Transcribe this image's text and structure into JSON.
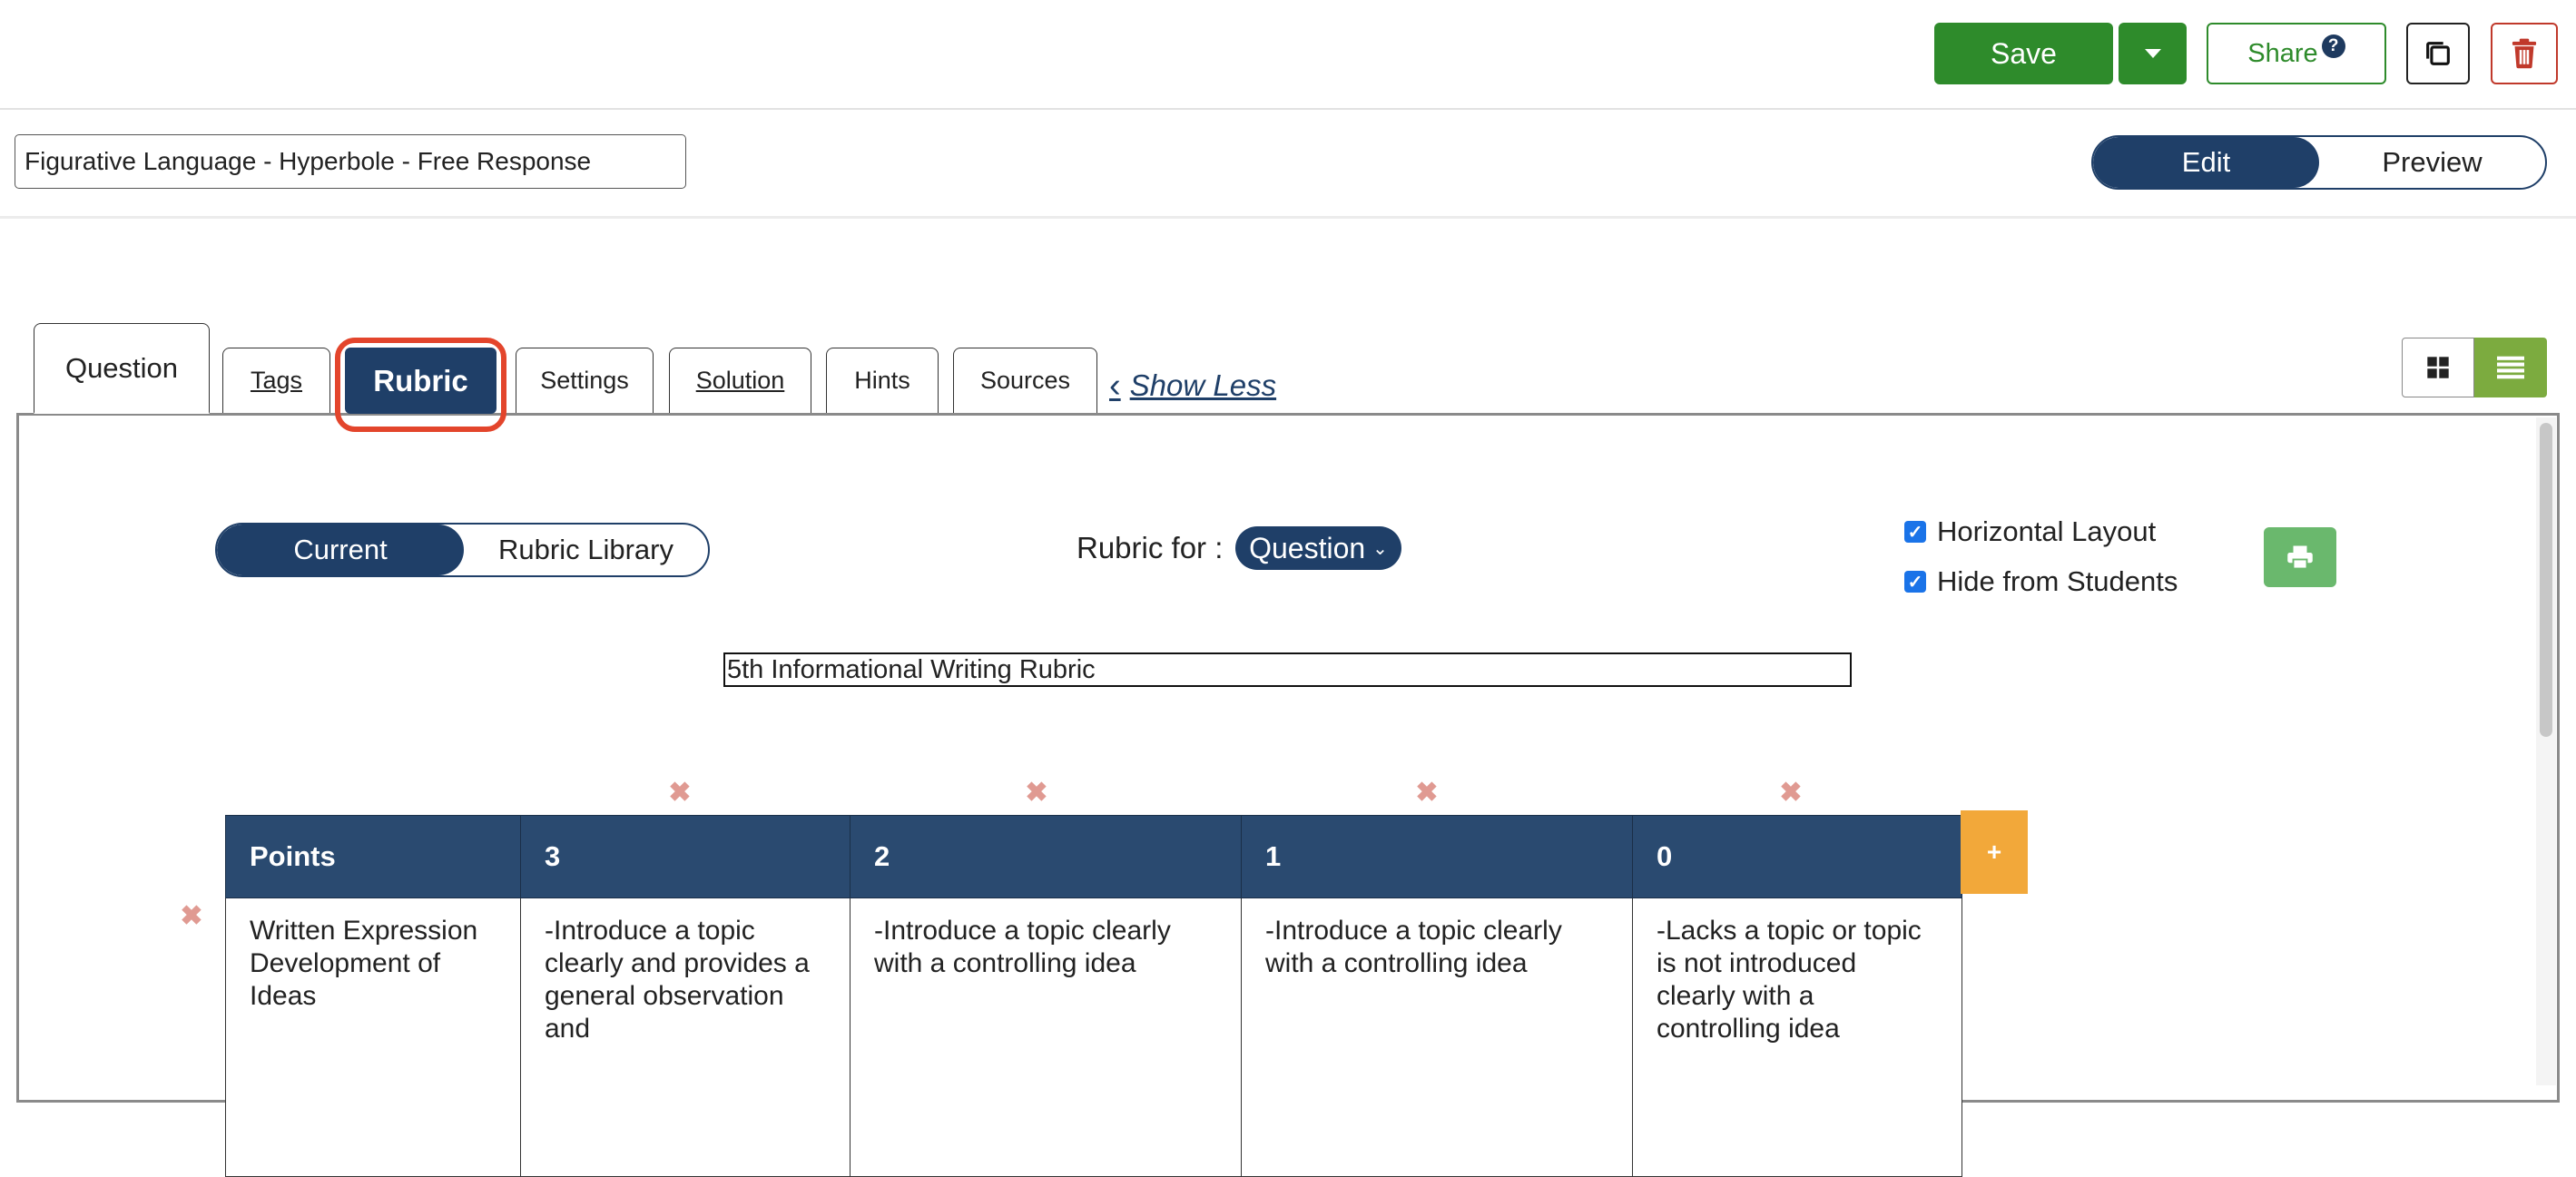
{
  "toolbar": {
    "save_label": "Save",
    "share_label": "Share",
    "help_icon_glyph": "?",
    "icons": [
      "caret-down-icon",
      "help-icon",
      "copy-icon",
      "trash-icon"
    ],
    "colors": {
      "save": "#2e8b2b",
      "delete": "#c0392b"
    }
  },
  "title_field": {
    "value": "Figurative Language - Hyperbole - Free Response"
  },
  "mode_toggle": {
    "edit_label": "Edit",
    "preview_label": "Preview",
    "active": "Edit"
  },
  "tabs": {
    "question": "Question",
    "tags": "Tags",
    "rubric": "Rubric",
    "settings": "Settings",
    "solution": "Solution",
    "hints": "Hints",
    "sources": "Sources",
    "active": "Rubric",
    "show_less": "Show Less"
  },
  "view_toggle": {
    "active": "list",
    "icons": [
      "grid-view-icon",
      "list-view-icon"
    ]
  },
  "rubric_panel": {
    "source_toggle": {
      "current_label": "Current",
      "library_label": "Rubric Library",
      "active": "Current"
    },
    "rubric_for_label": "Rubric for :",
    "rubric_for_value": "Question",
    "horizontal_layout_label": "Horizontal Layout",
    "horizontal_layout_checked": true,
    "hide_from_students_label": "Hide from Students",
    "hide_from_students_checked": true,
    "rubric_title_value": "5th Informational Writing Rubric",
    "delete_glyph": "✖",
    "add_column_label": "+",
    "table": {
      "headers": [
        "Points",
        "3",
        "2",
        "1",
        "0"
      ],
      "rows": [
        {
          "criterion": "Written Expression Development of Ideas",
          "cells": [
            "-Introduce a topic clearly and provides a general observation and",
            "-Introduce a topic clearly with a controlling idea",
            "-Introduce a topic clearly with a controlling idea",
            "-Lacks a topic or topic is not introduced clearly with a controlling idea"
          ]
        }
      ]
    }
  }
}
